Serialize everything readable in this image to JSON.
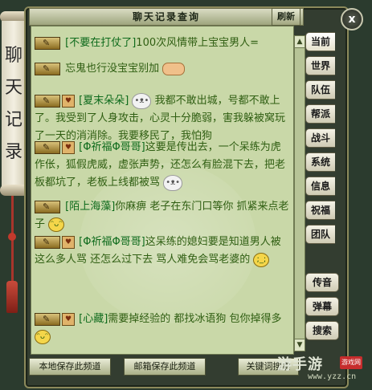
{
  "window": {
    "title": "聊天记录查询",
    "refresh_label": "刷新",
    "close_label": "x",
    "scroll_title": "聊天记录"
  },
  "side_tabs": [
    "当前",
    "世界",
    "队伍",
    "帮派",
    "战斗",
    "系统",
    "信息",
    "祝福",
    "团队"
  ],
  "side_lower": [
    "传音",
    "弹幕",
    "搜索"
  ],
  "bottom_buttons": {
    "save_local": "本地保存此频道",
    "save_mail": "邮箱保存此频道",
    "keyword": "关键词搜索"
  },
  "messages": [
    {
      "name": "[不要在打仗了]",
      "text": "100次风情带上宝宝男人="
    },
    {
      "name": "",
      "text": "忘鬼也行没宝宝别加"
    },
    {
      "name": "[夏末朵朵]",
      "text": "我都不敢出城，号都不敢上了。我受到了人身攻击，心灵十分脆弱，害我躲被窝玩了一天的消消除。我要移民了，我怕狗"
    },
    {
      "name": "[Φ祈福Φ哥哥]",
      "text": "这要是传出去，一个呆练为虎作伥，狐假虎威，虚张声势，还怎么有脸混下去，把老板都坑了，老板上线都被骂"
    },
    {
      "name": "[陌上海藻]",
      "text": "你麻痹  老子在东门口等你 抓紧来点老子"
    },
    {
      "name": "[Φ祈福Φ哥哥]",
      "text": "这呆练的媳妇要是知道男人被这么多人骂 还怎么过下去    骂人难免会骂老婆的"
    },
    {
      "name": "[心藏]",
      "text": "需要掉经验的   都找冰语狗   包你掉得多"
    }
  ],
  "watermark": {
    "brand": "游手游",
    "badge": "游戏网",
    "url": "www.yzz.cn"
  }
}
